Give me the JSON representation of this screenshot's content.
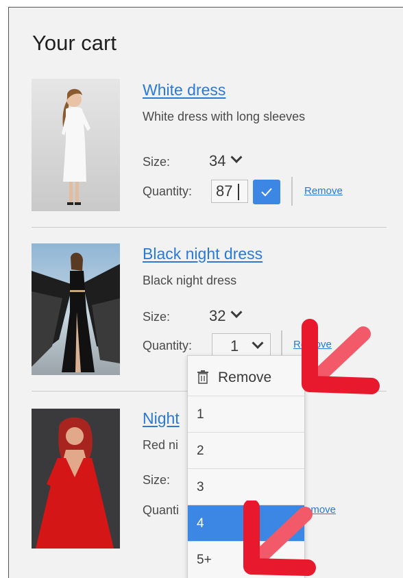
{
  "page": {
    "title": "Your cart"
  },
  "labels": {
    "size": "Size:",
    "quantity": "Quantity:",
    "remove": "Remove"
  },
  "items": [
    {
      "name": "White dress",
      "description": "White dress with long sleeves",
      "size": "34",
      "quantity": "87",
      "quantity_state": "editing"
    },
    {
      "name": "Black night dress",
      "description": "Black night dress",
      "size": "32",
      "quantity": "1",
      "quantity_state": "dropdown-open"
    },
    {
      "name": "Night",
      "description": "Red ni",
      "size_label_visible": "Size:",
      "quantity_label_visible": "Quanti",
      "remove_visible": "emove"
    }
  ],
  "quantity_dropdown": {
    "remove_option": "Remove",
    "options": [
      "1",
      "2",
      "3",
      "4",
      "5+"
    ],
    "selected": "4"
  },
  "annotations": {
    "arrow_color": "#e8192c",
    "arrow_highlight": "#f25a6a"
  },
  "colors": {
    "link": "#2a79d6",
    "accent": "#3b87e3",
    "background": "#f2f2f2"
  }
}
